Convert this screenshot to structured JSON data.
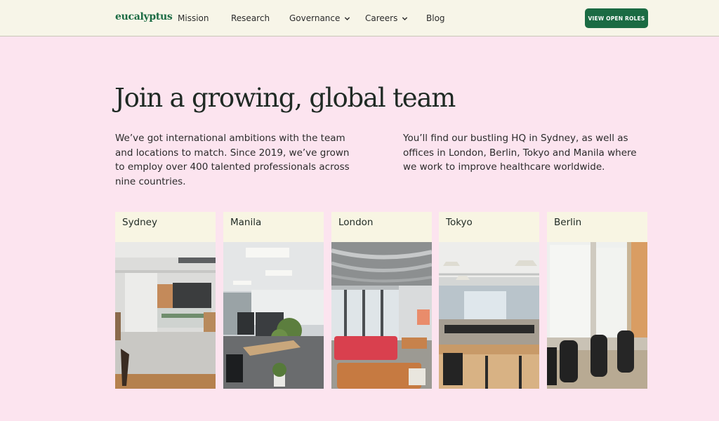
{
  "nav": {
    "logo": "eucalyptus",
    "items": [
      {
        "label": "Mission",
        "has_dropdown": false
      },
      {
        "label": "Research",
        "has_dropdown": false
      },
      {
        "label": "Governance",
        "has_dropdown": true
      },
      {
        "label": "Careers",
        "has_dropdown": true
      },
      {
        "label": "Blog",
        "has_dropdown": false
      }
    ],
    "cta_label": "VIEW OPEN ROLES"
  },
  "hero": {
    "title": "Join a growing, global team",
    "para_left": "We’ve got international ambitions with the team and locations to match. Since 2019, we’ve grown to employ over 400 talented professionals across nine countries.",
    "para_right": "You’ll find our bustling HQ in Sydney, as well as offices in London, Berlin, Tokyo and Manila where we work to improve healthcare worldwide."
  },
  "offices": [
    {
      "city": "Sydney"
    },
    {
      "city": "Manila"
    },
    {
      "city": "London"
    },
    {
      "city": "Tokyo"
    },
    {
      "city": "Berlin"
    }
  ],
  "colors": {
    "page_bg": "#fce4ef",
    "nav_bg": "#f7f5e8",
    "brand_green": "#1b6b43",
    "card_header_bg": "#f8f5e3"
  }
}
